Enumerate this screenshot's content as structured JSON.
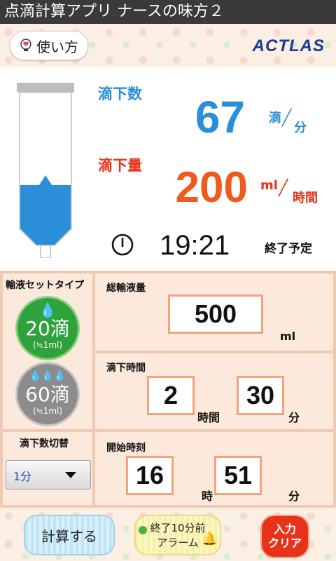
{
  "app": {
    "title": "点滴計算アプリ ナースの味方２"
  },
  "header": {
    "help_label": "使い方",
    "logo_text": "ACTLAS"
  },
  "result": {
    "drip_rate_label": "滴下数",
    "drip_rate_value": "67",
    "drip_rate_unit_top": "滴",
    "drip_rate_unit_bottom": "分",
    "flow_label": "滴下量",
    "flow_value": "200",
    "flow_unit_top": "ml",
    "flow_unit_bottom": "時間",
    "end_time": "19:21",
    "end_label": "終了予定",
    "bag_level_fraction": 0.32
  },
  "set_type": {
    "title": "輸液セットタイプ",
    "option_20_main": "20滴",
    "option_20_sub": "(≒1ml)",
    "option_60_main": "60滴",
    "option_60_sub": "(≒1ml)",
    "selected": "20滴"
  },
  "switch": {
    "title": "滴下数切替",
    "selected": "1分"
  },
  "total_volume": {
    "title": "総輸液量",
    "value": "500",
    "unit": "ml"
  },
  "drip_time": {
    "title": "滴下時間",
    "hours": "2",
    "hours_unit": "時間",
    "minutes": "30",
    "minutes_unit": "分"
  },
  "start_time": {
    "title": "開始時刻",
    "hour": "16",
    "hour_unit": "時",
    "minute": "51",
    "minute_unit": "分"
  },
  "footer": {
    "calc_label": "計算する",
    "alarm_line1": "終了10分前",
    "alarm_line2": "アラーム",
    "clear_line1": "入力",
    "clear_line2": "クリア"
  },
  "colors": {
    "blue": "#2a8fd8",
    "red": "#e8331c",
    "orange": "#f05a1e",
    "green": "#2fa23c",
    "gray": "#8c8c8c",
    "panel": "#f0c9b3"
  }
}
